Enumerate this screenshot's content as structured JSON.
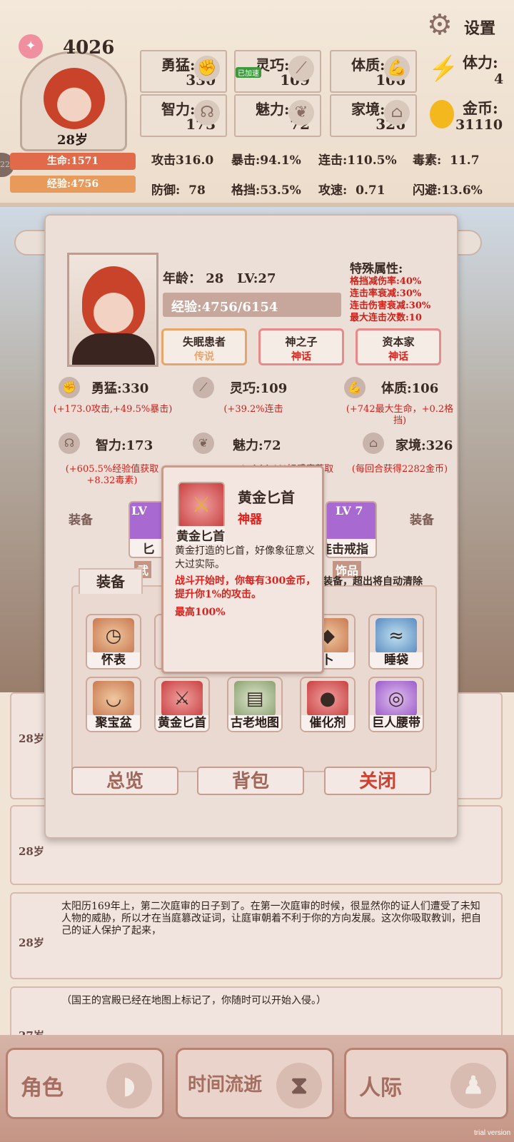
{
  "header": {
    "soul_points": "4026",
    "age_badge": "28岁",
    "life_bar": "生命:1571",
    "exp_bar": "经验:4756",
    "settings_label": "设置",
    "stats": [
      {
        "name": "勇猛:",
        "value": "330",
        "icon": "fist-icon"
      },
      {
        "name": "灵巧:",
        "value": "109",
        "icon": "feather-icon"
      },
      {
        "name": "体质:",
        "value": "106",
        "icon": "arm-icon"
      },
      {
        "name": "智力:",
        "value": "173",
        "icon": "brain-icon"
      },
      {
        "name": "魅力:",
        "value": "72",
        "icon": "flower-icon"
      },
      {
        "name": "家境:",
        "value": "326",
        "icon": "home-icon"
      }
    ],
    "stamina_label": "体力:",
    "stamina_value": "4",
    "gold_label": "金币:",
    "gold_value": "31110",
    "combat": [
      "攻击316.0",
      "暴击:94.1%",
      "连击:110.5%",
      "毒素:  11.7",
      "防御:  78",
      "格挡:53.5%",
      "攻速:  0.71",
      "闪避:13.6%"
    ],
    "overlay_small": "已加速"
  },
  "profile": {
    "age_line": "年龄： 28   LV:27",
    "exp_line": "经验:4756/6154",
    "special_title": "特殊属性:",
    "special": [
      "格挡减伤率:40%",
      "连击率衰减:30%",
      "连击伤害衰减:30%",
      "最大连击次数:10"
    ],
    "traits": [
      {
        "name": "失眠患者",
        "rarity": "传说"
      },
      {
        "name": "神之子",
        "rarity": "神话"
      },
      {
        "name": "资本家",
        "rarity": "神话"
      }
    ],
    "attributes": [
      {
        "name": "勇猛:330",
        "desc": "(+173.0攻击,+49.5%暴击)"
      },
      {
        "name": "灵巧:109",
        "desc": "(+39.2%连击"
      },
      {
        "name": "体质:106",
        "desc": "(+742最大生命，+0.2格挡)"
      },
      {
        "name": "智力:173",
        "desc": "(+605.5%经验值获取+8.32毒素)"
      },
      {
        "name": "魅力:72",
        "desc": "(+144.0%好感度获取"
      },
      {
        "name": "家境:326",
        "desc": "(每回合获得2282金币)"
      }
    ],
    "equip_label_left": "装备",
    "equip_label_right": "装备",
    "slots": [
      {
        "lv": "LV",
        "name": "匕",
        "cat": "武"
      },
      {
        "lv": "LV 7",
        "name": "连击戒指",
        "cat": "饰品"
      }
    ],
    "bag_tab": "装备",
    "bag_note": "装备，超出将自动清除",
    "items": [
      {
        "name": "怀表",
        "glyph": "◷"
      },
      {
        "name": "",
        "glyph": "□"
      },
      {
        "name": "",
        "glyph": "□"
      },
      {
        "name": "卜",
        "glyph": "◆"
      },
      {
        "name": "睡袋",
        "glyph": "≈"
      },
      {
        "name": "聚宝盆",
        "glyph": "◡"
      },
      {
        "name": "黄金匕首",
        "glyph": "⚔"
      },
      {
        "name": "古老地图",
        "glyph": "▤"
      },
      {
        "name": "催化剂",
        "glyph": "●"
      },
      {
        "name": "巨人腰带",
        "glyph": "◎"
      }
    ],
    "buttons": {
      "overview": "总览",
      "bag": "背包",
      "close": "关闭"
    }
  },
  "tooltip": {
    "title": "黄金匕首",
    "rarity": "神器",
    "label": "黄金匕首",
    "desc": "黄金打造的匕首，好像象征意义大过实际。",
    "effect": "战斗开始时，你每有300金币，提升你1%的攻击。",
    "cap": "最高100%"
  },
  "logs": [
    {
      "age": "28岁",
      "text": ""
    },
    {
      "age": "28岁",
      "text": ""
    },
    {
      "age": "28岁",
      "text": "太阳历169年上，第二次庭审的日子到了。在第一次庭审的时候，很显然你的证人们遭受了未知人物的威胁，所以才在当庭篡改证词，让庭审朝着不利于你的方向发展。这次你吸取教训，把自己的证人保护了起来，"
    },
    {
      "age": "27岁",
      "text": "（国王的宫殿已经在地图上标记了，你随时可以开始入侵。）"
    }
  ],
  "nav": [
    {
      "label": "角色",
      "icon": "mask-icon"
    },
    {
      "label": "时间流逝",
      "icon": "hourglass-icon"
    },
    {
      "label": "人际",
      "icon": "people-icon"
    }
  ],
  "watermark": "trial version",
  "colors": {
    "life": "#e06a4a",
    "exp": "#e89a5a",
    "rarity_red": "#e0201a",
    "legend_orange": "#e7a56a"
  }
}
